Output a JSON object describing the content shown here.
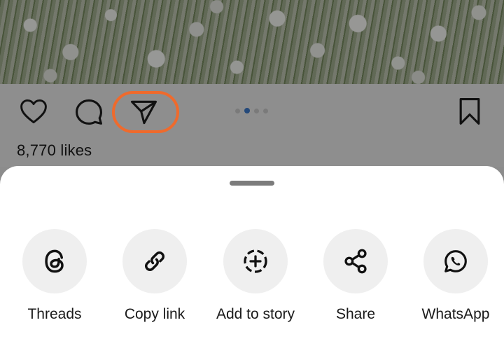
{
  "post": {
    "likes_text": "8,770 likes",
    "carousel": {
      "count": 4,
      "active_index": 1
    }
  },
  "action_bar": {
    "icons": [
      "heart-icon",
      "comment-icon",
      "paper-plane-icon",
      "bookmark-icon"
    ],
    "highlight_color": "#ef6a2c"
  },
  "share_sheet": {
    "options": [
      {
        "label": "Threads",
        "icon": "threads-icon"
      },
      {
        "label": "Copy link",
        "icon": "link-icon"
      },
      {
        "label": "Add to story",
        "icon": "add-to-story-icon"
      },
      {
        "label": "Share",
        "icon": "share-nodes-icon"
      },
      {
        "label": "WhatsApp",
        "icon": "whatsapp-icon"
      }
    ]
  }
}
